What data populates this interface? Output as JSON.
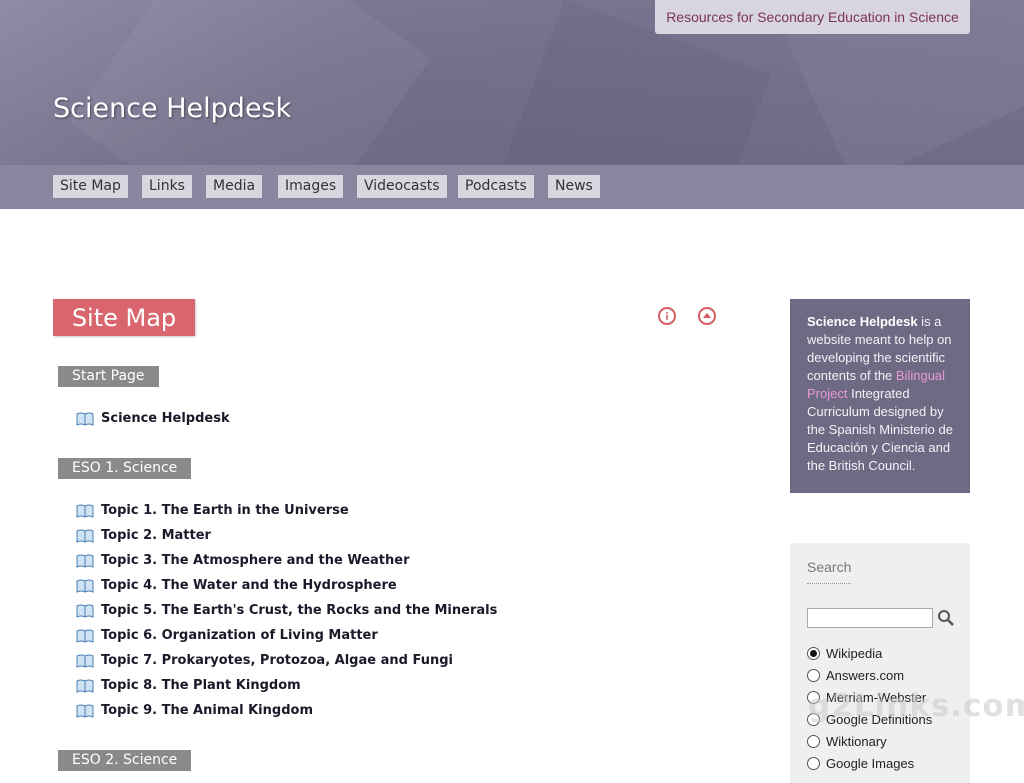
{
  "header": {
    "tagline": "Resources for Secondary Education in Science",
    "site_title": "Science Helpdesk"
  },
  "nav": {
    "items": [
      "Site Map",
      "Links",
      "Media",
      "Images",
      "Videocasts",
      "Podcasts",
      "News"
    ]
  },
  "main": {
    "page_title": "Site Map",
    "info_icon": "info-icon",
    "top_icon": "arrow-up-icon",
    "sections": [
      {
        "label": "Start Page",
        "items": [
          "Science Helpdesk"
        ]
      },
      {
        "label": "ESO 1. Science",
        "items": [
          "Topic 1. The Earth in the Universe",
          "Topic 2. Matter",
          "Topic 3. The Atmosphere and the Weather",
          "Topic 4. The Water and the Hydrosphere",
          "Topic 5. The Earth's Crust, the Rocks and the Minerals",
          "Topic 6. Organization of Living Matter",
          "Topic 7. Prokaryotes, Protozoa, Algae and Fungi",
          "Topic 8. The Plant Kingdom",
          "Topic 9. The Animal Kingdom"
        ]
      },
      {
        "label": "ESO 2. Science",
        "items": []
      }
    ]
  },
  "sidebar": {
    "about": {
      "name": "Science Helpdesk",
      "text1": " is a website meant to help on developing the scientific contents of the ",
      "link": "Bilingual Project",
      "text2": " Integrated Curriculum designed by the Spanish Ministerio de Educación y Ciencia and the British Council."
    },
    "search": {
      "title": "Search",
      "input_value": "",
      "options": [
        "Wikipedia",
        "Answers.com",
        "Merriam-Webster",
        "Google Definitions",
        "Wiktionary",
        "Google Images"
      ],
      "selected": "Wikipedia"
    }
  },
  "watermark": "g2Links.com",
  "colors": {
    "header": "#78728f",
    "nav": "#8a859e",
    "heading_bg": "#d9666e",
    "section_tag": "#8a8a8a",
    "sidebar_box": "#6e6a84",
    "link_pink": "#e79ad9"
  }
}
